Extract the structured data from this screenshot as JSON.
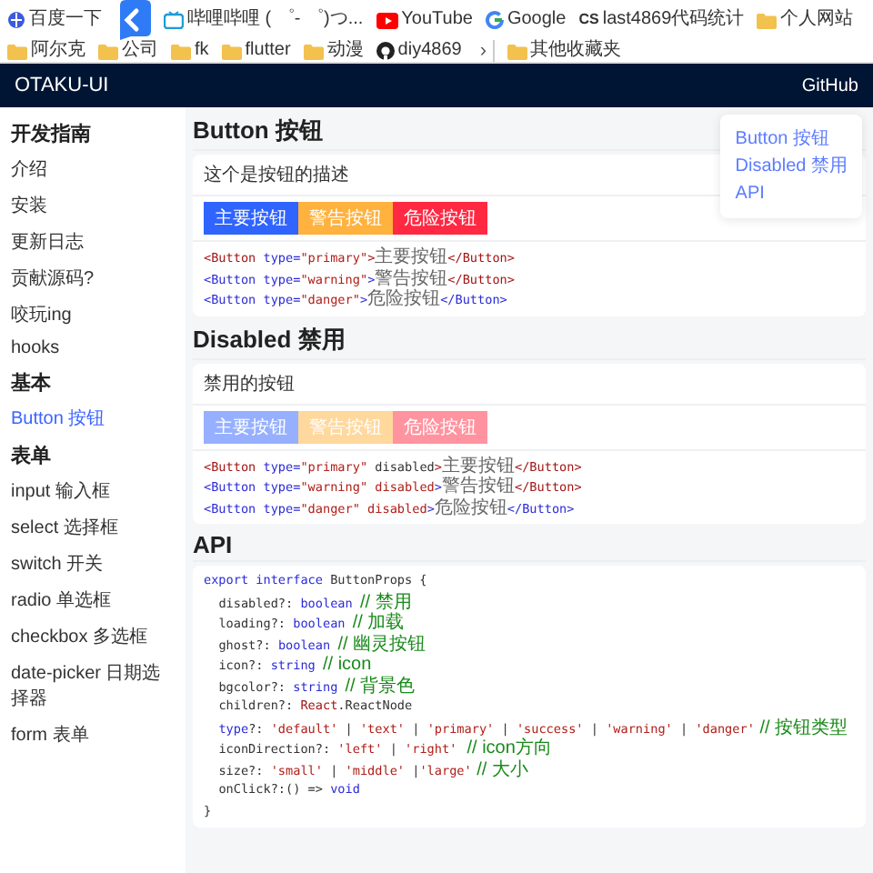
{
  "bookmarks": {
    "items": [
      {
        "kind": "site",
        "label": "百度一下"
      },
      {
        "kind": "overlay"
      },
      {
        "kind": "tv",
        "label": "哔哩哔哩 ( ゜- ゜)つ..."
      },
      {
        "kind": "video",
        "label": "YouTube"
      },
      {
        "kind": "search",
        "label": "Google"
      },
      {
        "kind": "badge",
        "badge": "CS",
        "label": "last4869代码统计"
      },
      {
        "kind": "folder",
        "label": "个人网站"
      },
      {
        "kind": "folder",
        "label": "阿尔克"
      },
      {
        "kind": "folder",
        "label": "公司"
      },
      {
        "kind": "folder",
        "label": "fk"
      },
      {
        "kind": "folder",
        "label": "flutter"
      },
      {
        "kind": "folder",
        "label": "动漫"
      },
      {
        "kind": "repo",
        "label": "diy4869"
      }
    ],
    "overflow": "›",
    "other": {
      "kind": "folder",
      "label": "其他收藏夹"
    }
  },
  "header": {
    "logo": "OTAKU-UI",
    "link": "GitHub"
  },
  "sidebar": {
    "groups": [
      {
        "title": "开发指南",
        "items": [
          {
            "label": "介绍",
            "selected": false
          },
          {
            "label": "安装",
            "selected": false
          },
          {
            "label": "更新日志",
            "selected": false
          },
          {
            "label": "贡献源码?",
            "selected": false
          },
          {
            "label": "咬玩ing",
            "selected": false
          },
          {
            "label": "hooks",
            "selected": false
          }
        ]
      },
      {
        "title": "基本",
        "items": [
          {
            "label": "Button 按钮",
            "selected": true
          }
        ]
      },
      {
        "title": "表单",
        "items": [
          {
            "label": "input 输入框",
            "selected": false
          },
          {
            "label": "select 选择框",
            "selected": false
          },
          {
            "label": "switch 开关",
            "selected": false
          },
          {
            "label": "radio 单选框",
            "selected": false
          },
          {
            "label": "checkbox 多选框",
            "selected": false
          },
          {
            "label": "date-picker 日期选择器",
            "selected": false
          },
          {
            "label": "form 表单",
            "selected": false
          }
        ]
      }
    ]
  },
  "toc": [
    {
      "label": "Button 按钮"
    },
    {
      "label": "Disabled 禁用"
    },
    {
      "label": "API"
    }
  ],
  "sections": [
    {
      "title": "Button 按钮",
      "description": "这个是按钮的描述",
      "buttons": [
        {
          "label": "主要按钮",
          "kind": "primary",
          "disabled": false
        },
        {
          "label": "警告按钮",
          "kind": "warning",
          "disabled": false
        },
        {
          "label": "危险按钮",
          "kind": "danger",
          "disabled": false
        }
      ],
      "code": [
        [
          {
            "text": "<Button ",
            "kind": "tag"
          },
          {
            "text": "type=",
            "kind": "attr"
          },
          {
            "text": "\"primary\"",
            "kind": "string"
          },
          {
            "text": ">",
            "kind": "tag"
          },
          {
            "text": "主要按钮",
            "kind": "cn"
          },
          {
            "text": "</Button>",
            "kind": "tag"
          }
        ],
        [
          {
            "text": "<Button ",
            "kind": "attr"
          },
          {
            "text": "type=",
            "kind": "attr"
          },
          {
            "text": "\"warning\"",
            "kind": "string"
          },
          {
            "text": ">",
            "kind": "attr"
          },
          {
            "text": "警告按钮",
            "kind": "cn"
          },
          {
            "text": "</Button>",
            "kind": "tag"
          }
        ],
        [
          {
            "text": "<Button ",
            "kind": "attr"
          },
          {
            "text": "type=",
            "kind": "attr"
          },
          {
            "text": "\"danger\"",
            "kind": "string"
          },
          {
            "text": ">",
            "kind": "attr"
          },
          {
            "text": "危险按钮",
            "kind": "cn"
          },
          {
            "text": "</Button>",
            "kind": "attr"
          }
        ]
      ]
    },
    {
      "title": "Disabled 禁用",
      "description": "禁用的按钮",
      "buttons": [
        {
          "label": "主要按钮",
          "kind": "primary",
          "disabled": true
        },
        {
          "label": "警告按钮",
          "kind": "warning",
          "disabled": true
        },
        {
          "label": "危险按钮",
          "kind": "danger",
          "disabled": true
        }
      ],
      "code": [
        [
          {
            "text": "<Button ",
            "kind": "tag"
          },
          {
            "text": "type=",
            "kind": "attr"
          },
          {
            "text": "\"primary\"",
            "kind": "string"
          },
          {
            "text": " disabled",
            "kind": "plain"
          },
          {
            "text": ">",
            "kind": "tag"
          },
          {
            "text": "主要按钮",
            "kind": "cn"
          },
          {
            "text": "</Button>",
            "kind": "tag"
          }
        ],
        [
          {
            "text": "<Button ",
            "kind": "attr"
          },
          {
            "text": "type=",
            "kind": "attr"
          },
          {
            "text": "\"warning\"",
            "kind": "string"
          },
          {
            "text": " disabled",
            "kind": "string"
          },
          {
            "text": ">",
            "kind": "attr"
          },
          {
            "text": "警告按钮",
            "kind": "cn"
          },
          {
            "text": "</Button>",
            "kind": "tag"
          }
        ],
        [
          {
            "text": "<Button ",
            "kind": "attr"
          },
          {
            "text": "type=",
            "kind": "attr"
          },
          {
            "text": "\"danger\"",
            "kind": "string"
          },
          {
            "text": " disabled",
            "kind": "string"
          },
          {
            "text": ">",
            "kind": "attr"
          },
          {
            "text": "危险按钮",
            "kind": "cn"
          },
          {
            "text": "</Button>",
            "kind": "attr"
          }
        ]
      ]
    },
    {
      "title": "API",
      "code": [
        [
          {
            "text": "export interface ",
            "kind": "keyword"
          },
          {
            "text": "ButtonProps {",
            "kind": "plain"
          }
        ],
        [
          {
            "text": "  disabled?: ",
            "kind": "plain"
          },
          {
            "text": "boolean ",
            "kind": "keyword"
          },
          {
            "text": "// 禁用",
            "kind": "comment"
          }
        ],
        [
          {
            "text": "  loading?: ",
            "kind": "plain"
          },
          {
            "text": "boolean ",
            "kind": "keyword"
          },
          {
            "text": "// 加载",
            "kind": "comment"
          }
        ],
        [
          {
            "text": "  ghost?: ",
            "kind": "plain"
          },
          {
            "text": "boolean ",
            "kind": "keyword"
          },
          {
            "text": "// 幽灵按钮",
            "kind": "comment"
          }
        ],
        [
          {
            "text": "  icon?: ",
            "kind": "plain"
          },
          {
            "text": "string ",
            "kind": "keyword"
          },
          {
            "text": "// icon",
            "kind": "comment"
          }
        ],
        [
          {
            "text": "  bgcolor?: ",
            "kind": "plain"
          },
          {
            "text": "string ",
            "kind": "keyword"
          },
          {
            "text": "// 背景色",
            "kind": "comment"
          }
        ],
        [
          {
            "text": "  children?: ",
            "kind": "plain"
          },
          {
            "text": "React",
            "kind": "tag"
          },
          {
            "text": ".ReactNode",
            "kind": "plain"
          }
        ],
        [
          {
            "text": "  type",
            "kind": "keyword"
          },
          {
            "text": "?: ",
            "kind": "plain"
          },
          {
            "text": "'default'",
            "kind": "string"
          },
          {
            "text": " | ",
            "kind": "plain"
          },
          {
            "text": "'text'",
            "kind": "string"
          },
          {
            "text": " | ",
            "kind": "plain"
          },
          {
            "text": "'primary'",
            "kind": "string"
          },
          {
            "text": " | ",
            "kind": "plain"
          },
          {
            "text": "'success'",
            "kind": "string"
          },
          {
            "text": " | ",
            "kind": "plain"
          },
          {
            "text": "'warning'",
            "kind": "string"
          },
          {
            "text": " | ",
            "kind": "plain"
          },
          {
            "text": "'danger'",
            "kind": "string"
          },
          {
            "text": " // 按钮类型",
            "kind": "comment"
          }
        ],
        [
          {
            "text": "  iconDirection?: ",
            "kind": "plain"
          },
          {
            "text": "'left'",
            "kind": "string"
          },
          {
            "text": " | ",
            "kind": "plain"
          },
          {
            "text": "'right'",
            "kind": "string"
          },
          {
            "text": "  // icon方向",
            "kind": "comment"
          }
        ],
        [
          {
            "text": "  size?: ",
            "kind": "plain"
          },
          {
            "text": "'small'",
            "kind": "string"
          },
          {
            "text": " | ",
            "kind": "plain"
          },
          {
            "text": "'middle'",
            "kind": "string"
          },
          {
            "text": " |",
            "kind": "plain"
          },
          {
            "text": "'large'",
            "kind": "string"
          },
          {
            "text": " // 大小",
            "kind": "comment"
          }
        ],
        [
          {
            "text": "  onClick?:() => ",
            "kind": "plain"
          },
          {
            "text": "void",
            "kind": "keyword"
          }
        ],
        [
          {
            "text": "}",
            "kind": "plain"
          }
        ]
      ]
    }
  ]
}
